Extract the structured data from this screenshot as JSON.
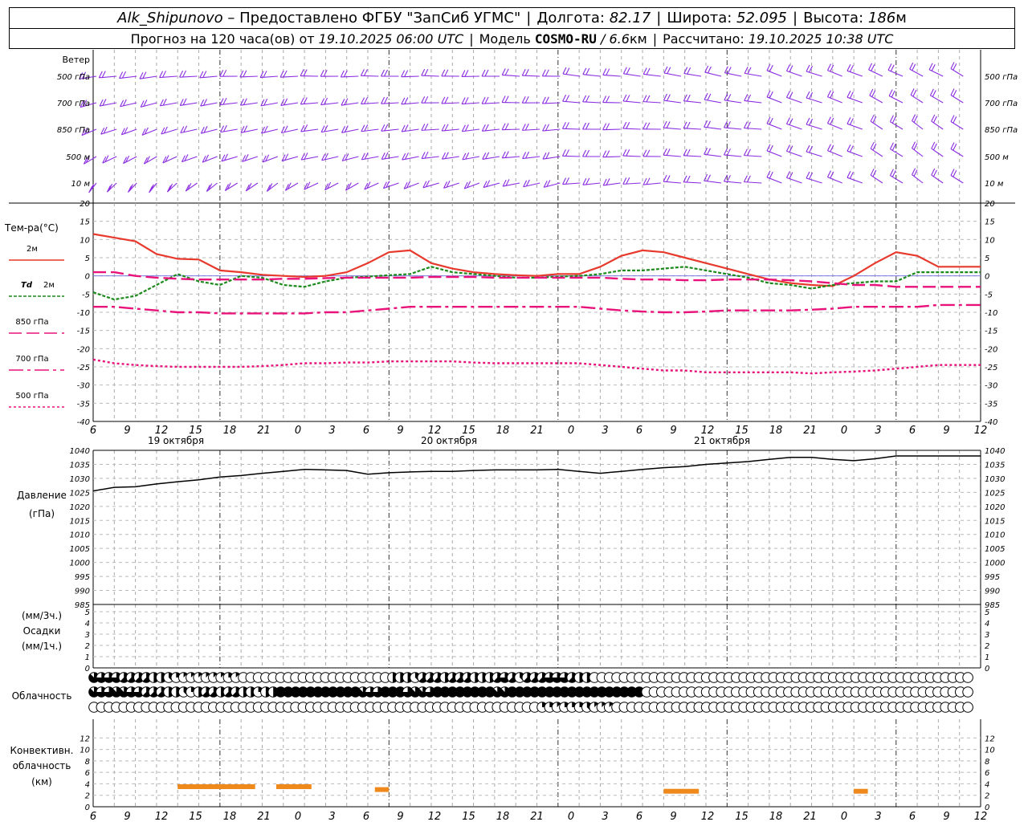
{
  "header": {
    "station": "Alk_Shipunovo",
    "provided": "– Предоставлено ФГБУ \"ЗапСиб УГМС\"",
    "lon_label": "Долгота:",
    "lon": "82.17",
    "lat_label": "Широта:",
    "lat": "52.095",
    "alt_label": "Высота:",
    "alt": "186",
    "alt_unit": "м",
    "forecast_label": "Прогноз на 120 часа(ов) от",
    "run_time": "19.10.2025 06:00 UTC",
    "model_label": "Модель",
    "model": "COSMO-RU",
    "res_sep": "/",
    "resolution": "6.6",
    "res_unit": "км",
    "calc_label": "Рассчитано:",
    "calc_time": "19.10.2025 10:38 UTC"
  },
  "chart_data": [
    {
      "type": "wind_barbs",
      "title": "Ветер",
      "levels": [
        "500 гПа",
        "700 гПа",
        "850 гПа",
        "500 м",
        "10 м"
      ],
      "color": "#8a2be2",
      "direction_trend_deg": [
        [
          260,
          265,
          270,
          270,
          275,
          280,
          290,
          300,
          310,
          320
        ],
        [
          250,
          255,
          260,
          265,
          270,
          275,
          285,
          300,
          315,
          320
        ],
        [
          240,
          250,
          255,
          260,
          265,
          270,
          280,
          300,
          320,
          320
        ],
        [
          230,
          240,
          250,
          255,
          260,
          270,
          280,
          300,
          320,
          320
        ],
        [
          210,
          220,
          230,
          240,
          250,
          260,
          280,
          300,
          320,
          320
        ]
      ]
    },
    {
      "type": "line",
      "title": "Тем-ра(°C)",
      "ylim": [
        -40,
        20
      ],
      "yticks": [
        20,
        15,
        10,
        5,
        0,
        -5,
        -10,
        -15,
        -20,
        -25,
        -30,
        -35,
        -40
      ],
      "x_hours_from_start": [
        0,
        3,
        6,
        9,
        12,
        15,
        18,
        21,
        24,
        27,
        30,
        33,
        36,
        39,
        42,
        45,
        48,
        51,
        54,
        57,
        60,
        63,
        66,
        69,
        72,
        75,
        78,
        81,
        84,
        87,
        90,
        93,
        96,
        99,
        102,
        105,
        108,
        111,
        114,
        117,
        120,
        123,
        126
      ],
      "series": [
        {
          "name": "2м",
          "color": "#e8392d",
          "dash": "",
          "values": [
            11.5,
            10.5,
            9.5,
            6.0,
            4.7,
            4.5,
            1.5,
            1.0,
            0.3,
            0.0,
            -0.3,
            0.0,
            1.0,
            3.5,
            6.5,
            7.0,
            3.5,
            2.0,
            1.0,
            0.5,
            0.2,
            0.0,
            0.5,
            0.5,
            2.5,
            5.5,
            7.0,
            6.5,
            5.0,
            3.5,
            2.0,
            0.5,
            -1.0,
            -2.0,
            -2.5,
            -2.8,
            0.0,
            3.5,
            6.5,
            5.5,
            2.5,
            2.5,
            2.5
          ]
        },
        {
          "name": "Td 2м",
          "color": "#1a8a1a",
          "dash": "4,2",
          "values": [
            -4.5,
            -6.5,
            -5.5,
            -2.5,
            0.5,
            -1.5,
            -2.5,
            0.0,
            -0.5,
            -2.5,
            -3.0,
            -1.5,
            -0.5,
            -0.2,
            0.2,
            0.5,
            2.5,
            1.0,
            0.5,
            0.0,
            -0.5,
            -0.5,
            -0.2,
            0.0,
            0.5,
            1.5,
            1.5,
            2.0,
            2.5,
            1.5,
            0.5,
            -0.5,
            -2.0,
            -2.5,
            -3.5,
            -2.5,
            -2.0,
            -1.5,
            -1.5,
            1.0,
            1.0,
            1.0,
            1.0
          ]
        },
        {
          "name": "850 гПа",
          "color": "#e8127a",
          "dash": "16,6",
          "values": [
            1.0,
            1.0,
            0.0,
            -0.5,
            -0.8,
            -1.0,
            -1.0,
            -1.0,
            -1.0,
            -0.8,
            -0.8,
            -0.6,
            -0.5,
            -0.5,
            -0.5,
            -0.5,
            -0.3,
            -0.3,
            -0.3,
            -0.5,
            -0.5,
            -0.5,
            -0.5,
            -0.5,
            -0.5,
            -0.8,
            -1.0,
            -1.0,
            -1.2,
            -1.2,
            -1.0,
            -1.0,
            -1.0,
            -1.2,
            -1.5,
            -2.0,
            -2.5,
            -2.5,
            -3.0,
            -3.0,
            -3.0,
            -3.0,
            -3.0
          ]
        },
        {
          "name": "700 гПа",
          "color": "#e8127a",
          "dash": "18,5,4,5",
          "values": [
            -8.5,
            -8.5,
            -9.0,
            -9.5,
            -10.0,
            -10.0,
            -10.3,
            -10.3,
            -10.3,
            -10.3,
            -10.3,
            -10.0,
            -10.0,
            -9.5,
            -9.0,
            -8.5,
            -8.5,
            -8.5,
            -8.5,
            -8.5,
            -8.5,
            -8.5,
            -8.5,
            -8.5,
            -9.0,
            -9.5,
            -9.8,
            -10.0,
            -10.0,
            -9.8,
            -9.5,
            -9.5,
            -9.5,
            -9.5,
            -9.3,
            -9.0,
            -8.5,
            -8.5,
            -8.5,
            -8.5,
            -8.0,
            -8.0,
            -8.0
          ]
        },
        {
          "name": "500 гПа",
          "color": "#e8127a",
          "dash": "3,3",
          "values": [
            -23.0,
            -24.0,
            -24.5,
            -24.8,
            -25.0,
            -25.0,
            -25.0,
            -25.0,
            -24.8,
            -24.5,
            -24.0,
            -24.0,
            -23.8,
            -23.8,
            -23.5,
            -23.5,
            -23.5,
            -23.5,
            -23.8,
            -24.0,
            -24.0,
            -24.0,
            -24.0,
            -24.0,
            -24.5,
            -25.0,
            -25.5,
            -26.0,
            -26.0,
            -26.5,
            -26.5,
            -26.5,
            -26.5,
            -26.5,
            -26.8,
            -26.5,
            -26.3,
            -26.0,
            -25.5,
            -25.0,
            -24.5,
            -24.5,
            -24.5
          ]
        }
      ]
    },
    {
      "type": "line",
      "title": "Давление",
      "unit": "(гПа)",
      "ylim": [
        985,
        1040
      ],
      "yticks": [
        1040,
        1035,
        1030,
        1025,
        1020,
        1015,
        1010,
        1005,
        1000,
        995,
        990,
        985
      ],
      "series": [
        {
          "name": "",
          "color": "#000000",
          "values": [
            1025.5,
            1026.8,
            1027.0,
            1028.0,
            1028.8,
            1029.5,
            1030.5,
            1031.0,
            1031.8,
            1032.5,
            1033.2,
            1033.0,
            1032.8,
            1031.5,
            1032.0,
            1032.3,
            1032.5,
            1032.5,
            1032.8,
            1033.0,
            1033.0,
            1033.0,
            1033.2,
            1032.5,
            1031.8,
            1032.5,
            1033.2,
            1033.8,
            1034.2,
            1035.0,
            1035.5,
            1036.0,
            1036.8,
            1037.5,
            1037.5,
            1036.8,
            1036.3,
            1037.0,
            1038.0,
            1038.0,
            1038.0,
            1038.0,
            1038.0
          ]
        }
      ]
    },
    {
      "type": "bar",
      "title": "Осадки",
      "ylabel_top": "(мм/3ч.)",
      "ylabel_bottom": "(мм/1ч.)",
      "ylim": [
        0,
        5
      ],
      "yticks": [
        5,
        4,
        3,
        2,
        1,
        0
      ],
      "values": []
    },
    {
      "type": "cloud_cover",
      "title": "Облачность",
      "rows": [
        "7666555544321111112100000000000000000000444355545554445653555666544000000000000000000000000000000000000000000000000000",
        "7667766555443245545544244888888888887668886776888888887788888888888888888800000000000000000000000000000000000000000000",
        "0000000000000000000000000000000000000000000000000000000000002212223111000000000000000000000000000000000000000000000000"
      ]
    },
    {
      "type": "bar",
      "title": "Конвективн. облачность",
      "unit": "(км)",
      "ylim": [
        0,
        14
      ],
      "yticks": [
        12,
        10,
        8,
        6,
        4,
        2,
        0
      ],
      "color": "#f0891c",
      "segments": [
        {
          "start_h": 12,
          "end_h": 23,
          "top_km": 3.5
        },
        {
          "start_h": 26,
          "end_h": 31,
          "top_km": 3.5
        },
        {
          "start_h": 40,
          "end_h": 42,
          "top_km": 3.0
        },
        {
          "start_h": 81,
          "end_h": 86,
          "top_km": 2.7
        },
        {
          "start_h": 108,
          "end_h": 110,
          "top_km": 2.7
        }
      ]
    }
  ],
  "xaxis": {
    "hour_ticks": [
      "6",
      "9",
      "12",
      "15",
      "18",
      "21",
      "0",
      "3",
      "6",
      "9",
      "12",
      "15",
      "18",
      "21",
      "0",
      "3",
      "6",
      "9",
      "12",
      "15",
      "18",
      "21",
      "0",
      "3",
      "6",
      "9",
      "12"
    ],
    "day_labels": [
      "19 октября",
      "20 октября",
      "21 октября"
    ]
  },
  "legend": {
    "t2m": "2м",
    "td_prefix": "Td",
    "td": "2м",
    "t850": "850 гПа",
    "t700": "700 гПа",
    "t500": "500 гПа"
  },
  "labels": {
    "conv_line1": "Конвективн.",
    "conv_line2": "облачность"
  }
}
